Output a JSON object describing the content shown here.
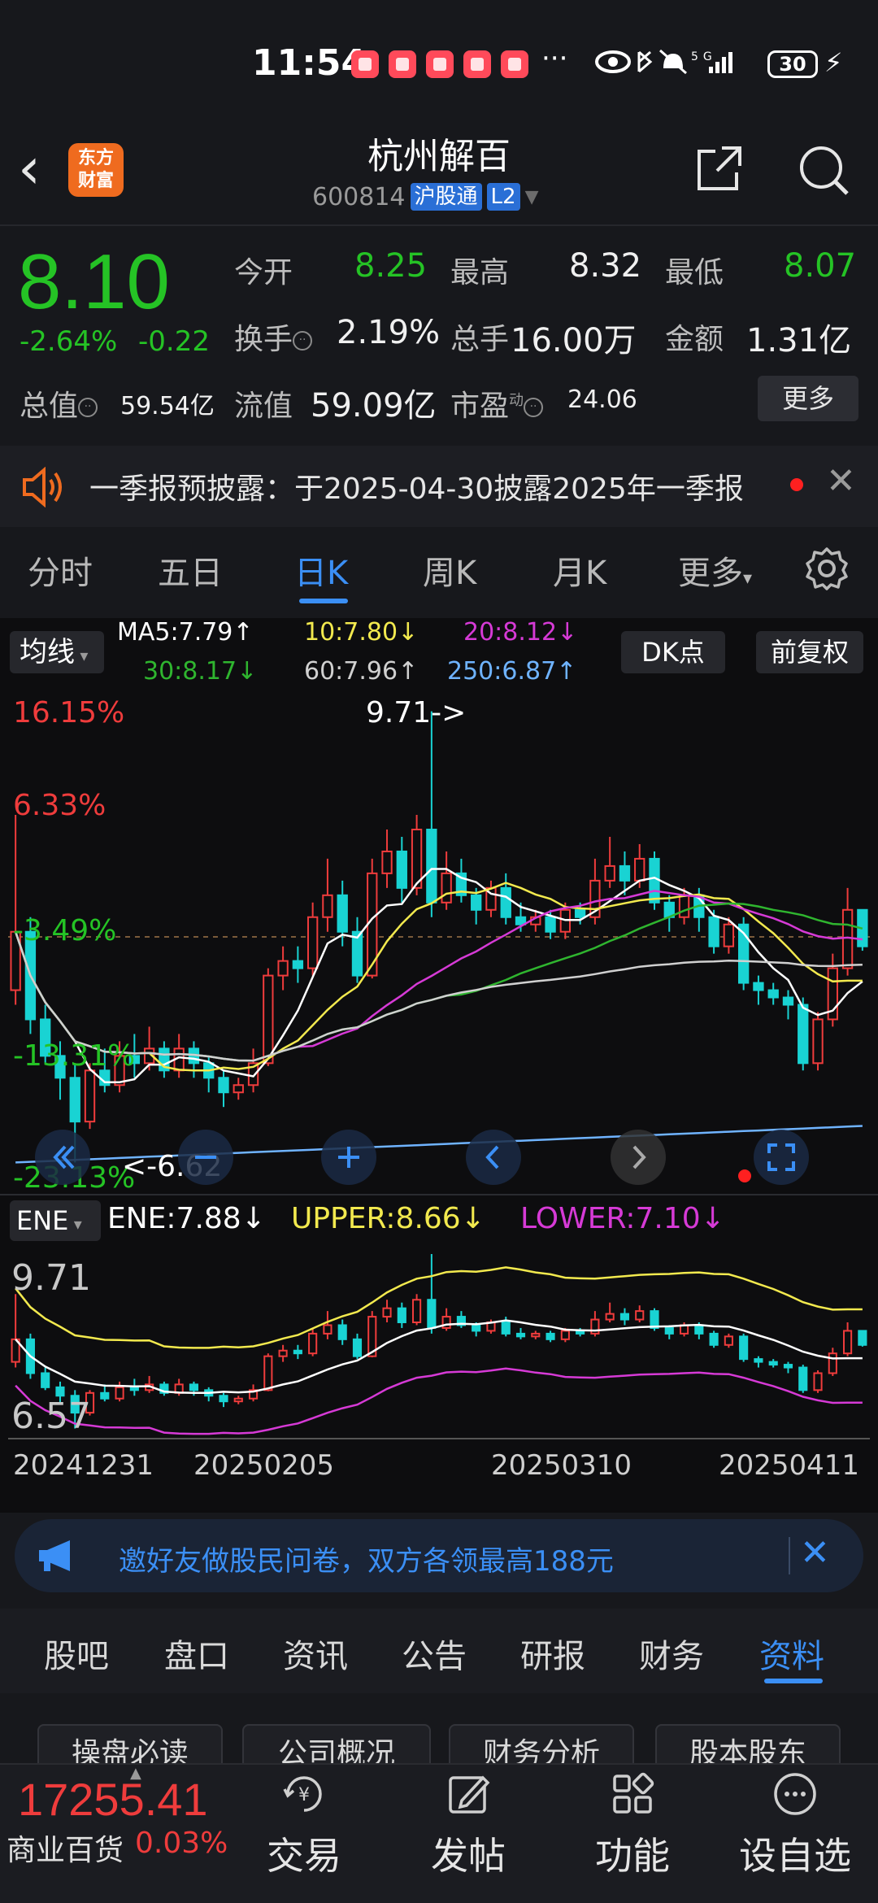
{
  "status": {
    "time": "11:54",
    "dots": "···",
    "battery": "30",
    "network": "5G"
  },
  "header": {
    "logo_text_1": "东方",
    "logo_text_2": "财富",
    "title": "杭州解百",
    "code": "600814",
    "tag_hgt": "沪股通",
    "tag_level": "L2"
  },
  "quote": {
    "price": "8.10",
    "change_pct": "-2.64%",
    "change_abs": "-0.22",
    "open_label": "今开",
    "open": "8.25",
    "high_label": "最高",
    "high": "8.32",
    "low_label": "最低",
    "low": "8.07",
    "turnover_label": "换手",
    "turnover": "2.19%",
    "volume_label": "总手",
    "volume": "16.00万",
    "amount_label": "金额",
    "amount": "1.31亿",
    "mktcap_label": "总值",
    "mktcap": "59.54亿",
    "float_label": "流值",
    "float_cap": "59.09亿",
    "pe_label": "市盈",
    "pe_sup": "动",
    "pe": "24.06",
    "more": "更多"
  },
  "notice": {
    "text": "一季报预披露：于2025-04-30披露2025年一季报"
  },
  "period_tabs": [
    "分时",
    "五日",
    "日K",
    "周K",
    "月K",
    "更多"
  ],
  "period_active": "日K",
  "ma": {
    "select": "均线",
    "ma5": "MA5:7.79↑",
    "ma10": "10:7.80↓",
    "ma20": "20:8.12↓",
    "ma30": "30:8.17↓",
    "ma60": "60:7.96↑",
    "ma250": "250:6.87↑",
    "dk": "DK点",
    "adj": "前复权",
    "colors": {
      "ma5": "#ffffff",
      "ma10": "#f2e94e",
      "ma20": "#d63ad6",
      "ma30": "#2fb52f",
      "ma60": "#d0d0d0",
      "ma250": "#6fb3ff"
    }
  },
  "kchart": {
    "pct_labels": [
      "16.15%",
      "6.33%",
      "-3.49%",
      "-13.31%",
      "-23.13%"
    ],
    "high_marker": "9.71->",
    "low_marker": "<-6.62"
  },
  "ene": {
    "select": "ENE",
    "ene": "ENE:7.88↓",
    "upper": "UPPER:8.66↓",
    "lower": "LOWER:7.10↓",
    "top_label": "9.71",
    "bottom_label": "6.57"
  },
  "dates": [
    "20241231",
    "20250205",
    "20250310",
    "20250411"
  ],
  "promo": {
    "text": "邀好友做股民问卷，双方各领最高188元"
  },
  "info_tabs": [
    "股吧",
    "盘口",
    "资讯",
    "公告",
    "研报",
    "财务",
    "资料"
  ],
  "info_active": "资料",
  "chips": [
    "操盘必读",
    "公司概况",
    "财务分析",
    "股本股东"
  ],
  "bottom": {
    "index_value": "17255.41",
    "index_name": "商业百货",
    "index_pct": "0.03%",
    "nav": [
      "交易",
      "发帖",
      "功能",
      "设自选"
    ]
  },
  "chart_data": {
    "type": "candlestick",
    "title": "",
    "x_ticks": [
      "20241231",
      "20250205",
      "20250310",
      "20250411"
    ],
    "price_high": 9.71,
    "price_low": 6.62,
    "last_close": 8.1,
    "ma": {
      "MA5": 7.79,
      "MA10": 7.8,
      "MA20": 8.12,
      "MA30": 8.17,
      "MA60": 7.96,
      "MA250": 6.87
    },
    "ene": {
      "ENE": 7.88,
      "UPPER": 8.66,
      "LOWER": 7.1
    },
    "ene_range": [
      6.57,
      9.71
    ],
    "candles": [
      [
        7.8,
        8.2,
        9.0,
        7.7
      ],
      [
        8.2,
        7.6,
        8.3,
        7.5
      ],
      [
        7.6,
        7.35,
        7.7,
        7.3
      ],
      [
        7.35,
        7.2,
        7.45,
        7.05
      ],
      [
        7.2,
        6.9,
        7.3,
        6.62
      ],
      [
        6.9,
        7.25,
        7.3,
        6.85
      ],
      [
        7.25,
        7.15,
        7.4,
        7.1
      ],
      [
        7.15,
        7.35,
        7.45,
        7.1
      ],
      [
        7.35,
        7.3,
        7.5,
        7.2
      ],
      [
        7.3,
        7.4,
        7.55,
        7.25
      ],
      [
        7.4,
        7.25,
        7.45,
        7.2
      ],
      [
        7.25,
        7.4,
        7.5,
        7.2
      ],
      [
        7.4,
        7.3,
        7.45,
        7.2
      ],
      [
        7.3,
        7.2,
        7.35,
        7.1
      ],
      [
        7.2,
        7.1,
        7.25,
        7.0
      ],
      [
        7.1,
        7.15,
        7.2,
        7.05
      ],
      [
        7.15,
        7.3,
        7.4,
        7.1
      ],
      [
        7.3,
        7.9,
        7.95,
        7.28
      ],
      [
        7.9,
        8.0,
        8.1,
        7.8
      ],
      [
        8.0,
        7.95,
        8.1,
        7.85
      ],
      [
        7.95,
        8.3,
        8.4,
        7.9
      ],
      [
        8.3,
        8.45,
        8.7,
        8.2
      ],
      [
        8.45,
        8.2,
        8.55,
        8.1
      ],
      [
        8.2,
        7.9,
        8.3,
        7.85
      ],
      [
        7.9,
        8.6,
        8.7,
        7.88
      ],
      [
        8.6,
        8.75,
        8.9,
        8.5
      ],
      [
        8.75,
        8.5,
        8.85,
        8.4
      ],
      [
        8.5,
        8.9,
        9.0,
        8.45
      ],
      [
        8.9,
        8.4,
        9.71,
        8.3
      ],
      [
        8.4,
        8.6,
        8.75,
        8.35
      ],
      [
        8.6,
        8.45,
        8.7,
        8.4
      ],
      [
        8.45,
        8.35,
        8.5,
        8.25
      ],
      [
        8.35,
        8.5,
        8.55,
        8.3
      ],
      [
        8.5,
        8.3,
        8.6,
        8.25
      ],
      [
        8.3,
        8.25,
        8.4,
        8.2
      ],
      [
        8.25,
        8.3,
        8.35,
        8.2
      ],
      [
        8.3,
        8.2,
        8.35,
        8.15
      ],
      [
        8.2,
        8.35,
        8.4,
        8.15
      ],
      [
        8.35,
        8.3,
        8.4,
        8.25
      ],
      [
        8.3,
        8.55,
        8.7,
        8.25
      ],
      [
        8.55,
        8.65,
        8.85,
        8.5
      ],
      [
        8.65,
        8.55,
        8.75,
        8.45
      ],
      [
        8.55,
        8.7,
        8.8,
        8.5
      ],
      [
        8.7,
        8.4,
        8.75,
        8.35
      ],
      [
        8.4,
        8.3,
        8.45,
        8.2
      ],
      [
        8.3,
        8.45,
        8.5,
        8.25
      ],
      [
        8.45,
        8.3,
        8.5,
        8.2
      ],
      [
        8.3,
        8.1,
        8.35,
        8.05
      ],
      [
        8.1,
        8.25,
        8.3,
        8.05
      ],
      [
        8.25,
        7.85,
        8.3,
        7.8
      ],
      [
        7.85,
        7.8,
        7.9,
        7.7
      ],
      [
        7.8,
        7.75,
        7.85,
        7.7
      ],
      [
        7.75,
        7.7,
        7.8,
        7.6
      ],
      [
        7.7,
        7.3,
        7.75,
        7.25
      ],
      [
        7.3,
        7.6,
        7.65,
        7.25
      ],
      [
        7.6,
        7.95,
        8.05,
        7.55
      ],
      [
        7.95,
        8.35,
        8.5,
        7.9
      ],
      [
        8.35,
        8.1,
        8.32,
        8.07
      ]
    ]
  }
}
